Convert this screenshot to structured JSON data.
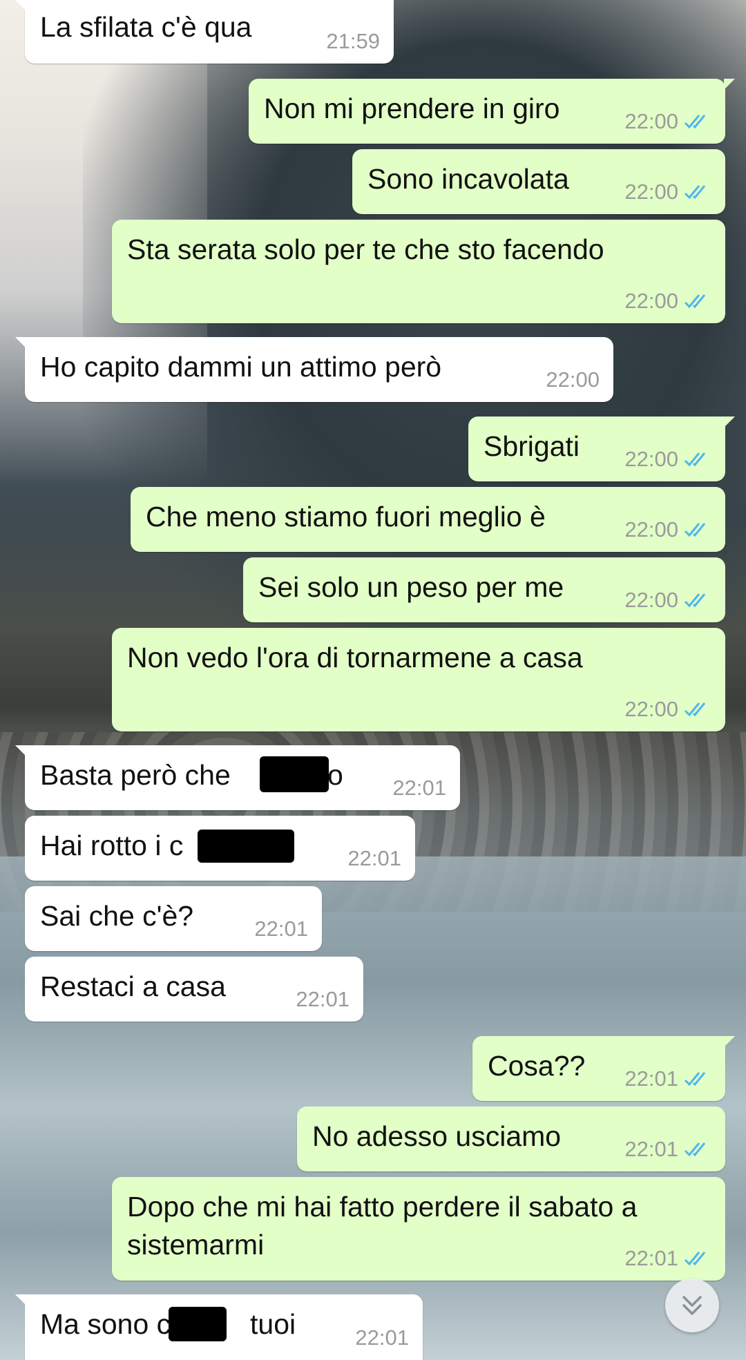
{
  "messages": [
    {
      "text": "La sfilata c'è qua",
      "time": "21:59"
    },
    {
      "text": "Non mi prendere in giro",
      "time": "22:00"
    },
    {
      "text": "Sono incavolata",
      "time": "22:00"
    },
    {
      "text": "Sta serata solo per te che sto facendo",
      "time": "22:00"
    },
    {
      "text": "Ho capito dammi un attimo però",
      "time": "22:00"
    },
    {
      "text": "Sbrigati",
      "time": "22:00"
    },
    {
      "text": "Che meno stiamo fuori meglio è",
      "time": "22:00"
    },
    {
      "text": "Sei solo un peso per me",
      "time": "22:00"
    },
    {
      "text": "Non vedo l'ora di tornarmene a casa",
      "time": "22:00"
    },
    {
      "text": "Basta però che",
      "text_after": "o",
      "time": "22:01"
    },
    {
      "text": "Hai rotto i c",
      "time": "22:01"
    },
    {
      "text": "Sai che c'è?",
      "time": "22:01"
    },
    {
      "text": "Restaci a casa",
      "time": "22:01"
    },
    {
      "text": "Cosa??",
      "time": "22:01"
    },
    {
      "text": "No adesso usciamo",
      "time": "22:01"
    },
    {
      "text": "Dopo che mi hai fatto perdere il sabato a sistemarmi",
      "time": "22:01"
    },
    {
      "text": "Ma sono c",
      "text_after": "tuoi",
      "time": "22:01"
    }
  ],
  "colors": {
    "incoming": "#ffffff",
    "outgoing": "#e2ffc7",
    "read_ticks": "#4fb6ec",
    "time": "#9a9a9a"
  },
  "icons": {
    "read_receipt": "double-check-icon",
    "scroll_down": "chevron-double-down-icon"
  }
}
